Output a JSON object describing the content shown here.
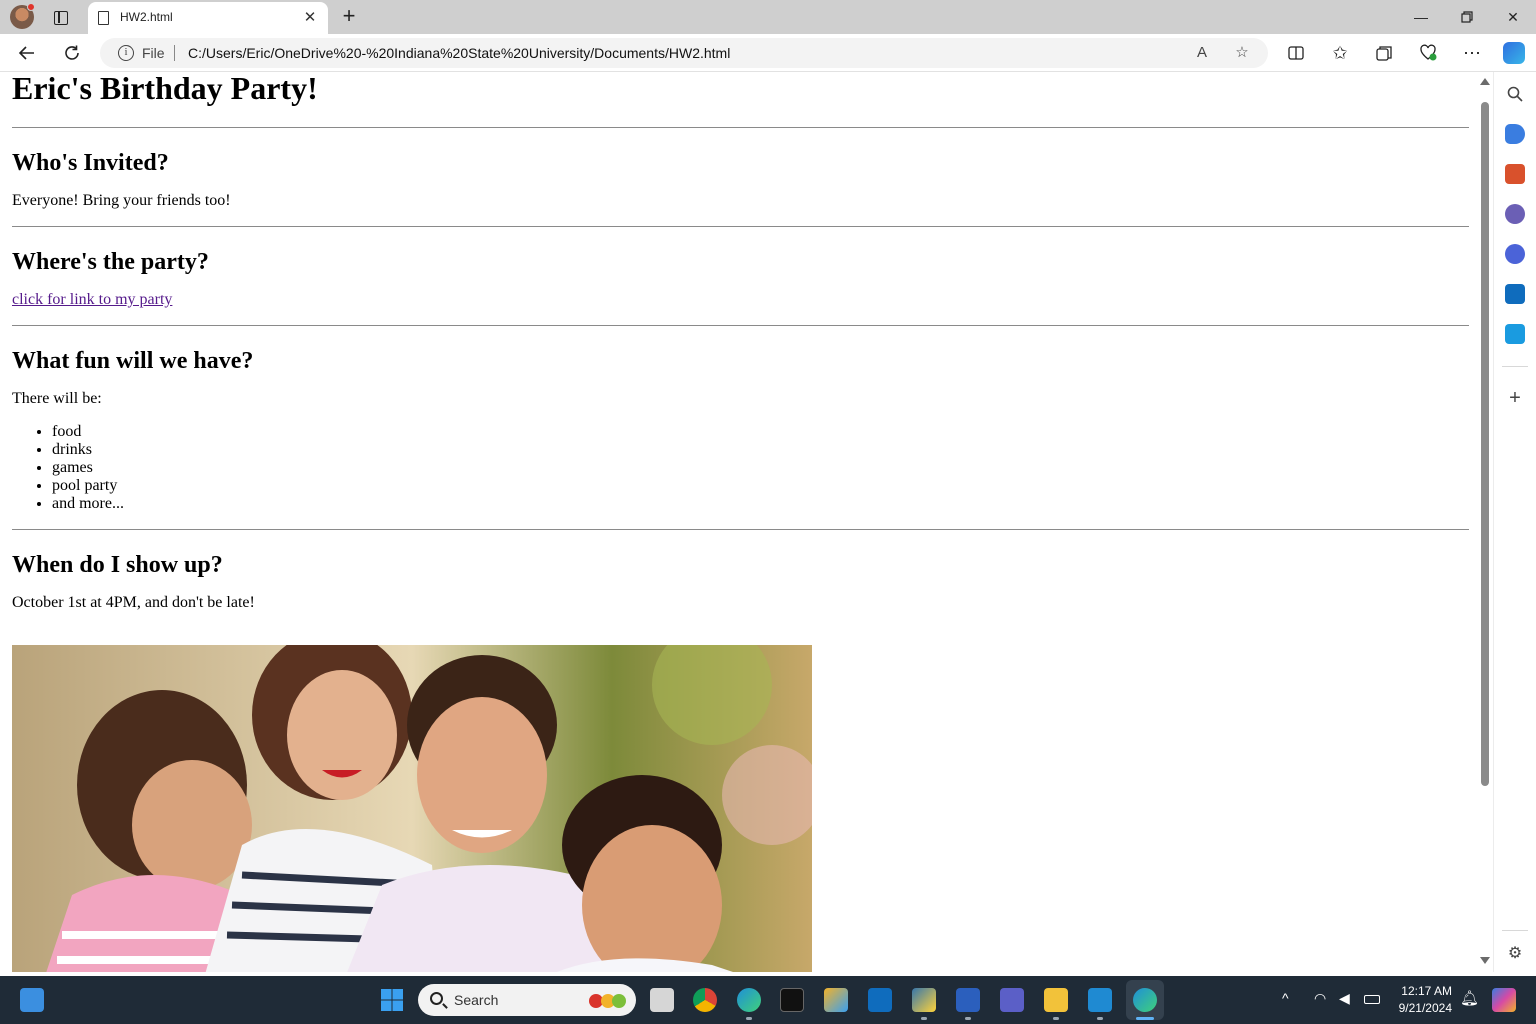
{
  "browser": {
    "tab_title": "HW2.html",
    "file_label": "File",
    "url": "C:/Users/Eric/OneDrive%20-%20Indiana%20State%20University/Documents/HW2.html"
  },
  "page": {
    "title": "Eric's Birthday Party!",
    "sections": [
      {
        "heading": "Who's Invited?",
        "text": "Everyone! Bring your friends too!"
      },
      {
        "heading": "Where's the party?",
        "link_text": "click for link to my party"
      },
      {
        "heading": "What fun will we have?",
        "text": "There will be:",
        "items": [
          "food",
          "drinks",
          "games",
          "pool party",
          "and more..."
        ]
      },
      {
        "heading": "When do I show up?",
        "text": "October 1st at 4PM, and don't be late!"
      }
    ],
    "link_color": "#551a8b"
  },
  "taskbar": {
    "search_label": "Search",
    "time": "12:17 AM",
    "date": "9/21/2024"
  },
  "colors": {
    "taskbar_bg": "#1f2b37",
    "tabbar_bg": "#cfcfcf",
    "accent": "#0078d4"
  }
}
